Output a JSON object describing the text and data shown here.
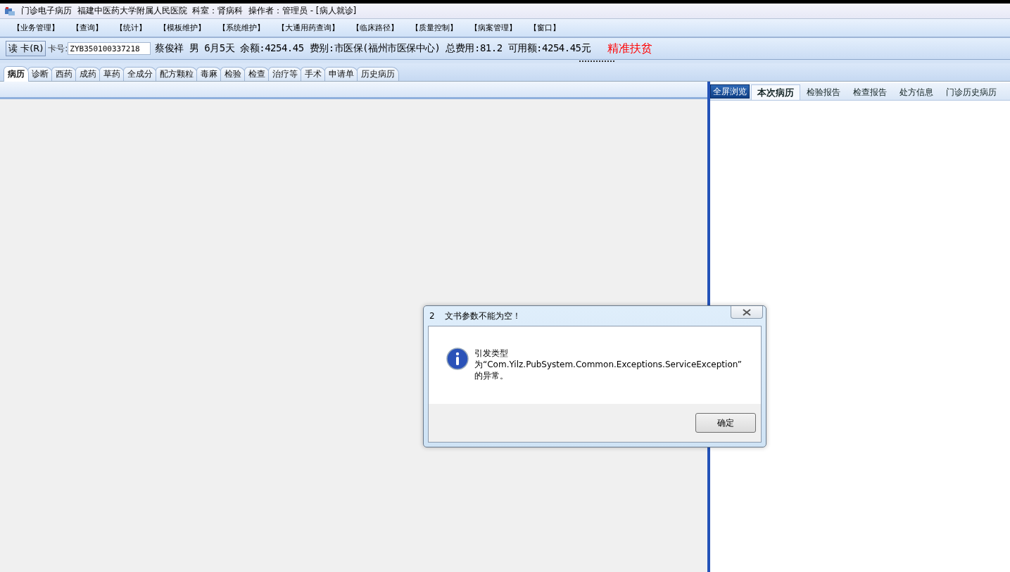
{
  "window": {
    "title": "门诊电子病历  福建中医药大学附属人民医院  科室：肾病科  操作者：管理员 - [病人就诊]"
  },
  "menu": [
    "【业务管理】",
    "【查询】",
    "【统计】",
    "【模板维护】",
    "【系统维护】",
    "【大通用药查询】",
    "【临床路径】",
    "【质量控制】",
    "【病案管理】",
    "【窗口】"
  ],
  "patient_bar": {
    "read_card_button": "读 卡(R)",
    "card_label": "卡号:",
    "card_number": "ZYB350100337218",
    "fields": [
      "蔡俊祥",
      "男",
      "6月5天",
      "余额:4254.45",
      "费别:市医保(福州市医保中心)",
      "总费用:81.2",
      "可用额:4254.45元"
    ],
    "tag": "精准扶贫"
  },
  "tabs": [
    {
      "label": "病历",
      "selected": true
    },
    {
      "label": "诊断",
      "selected": false
    },
    {
      "label": "西药",
      "selected": false
    },
    {
      "label": "成药",
      "selected": false
    },
    {
      "label": "草药",
      "selected": false
    },
    {
      "label": "全成分",
      "selected": false
    },
    {
      "label": "配方颗粒",
      "selected": false
    },
    {
      "label": "毒麻",
      "selected": false
    },
    {
      "label": "检验",
      "selected": false
    },
    {
      "label": "检查",
      "selected": false
    },
    {
      "label": "治疗等",
      "selected": false
    },
    {
      "label": "手术",
      "selected": false
    },
    {
      "label": "申请单",
      "selected": false
    },
    {
      "label": "历史病历",
      "selected": false
    }
  ],
  "right_panel": {
    "fullscreen_button": "全屏浏览",
    "tabs": [
      {
        "label": "本次病历",
        "selected": true
      },
      {
        "label": "检验报告",
        "selected": false
      },
      {
        "label": "检查报告",
        "selected": false
      },
      {
        "label": "处方信息",
        "selected": false
      },
      {
        "label": "门诊历史病历",
        "selected": false
      }
    ]
  },
  "dialog": {
    "number": "2",
    "title": "文书参数不能为空！",
    "message": "引发类型为“Com.Yilz.PubSystem.Common.Exceptions.ServiceException”的异常。",
    "ok_button": "确定"
  }
}
